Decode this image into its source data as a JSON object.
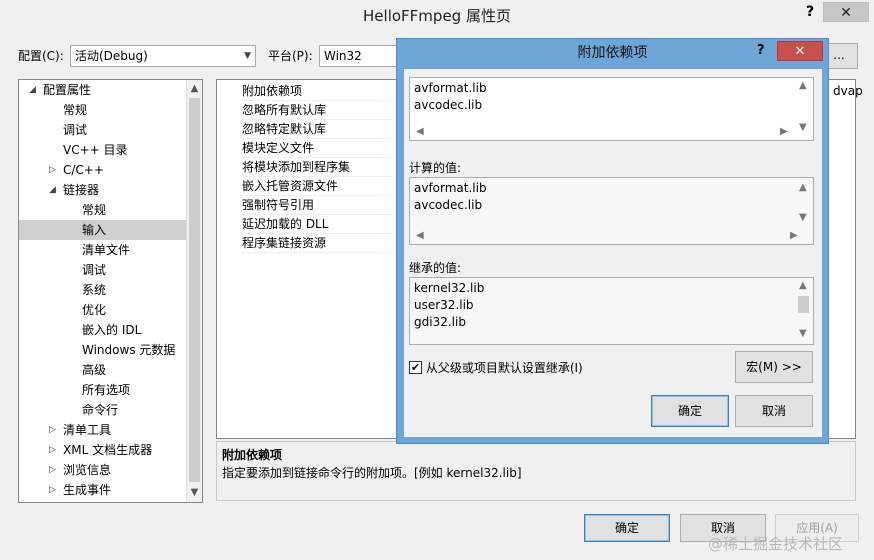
{
  "window": {
    "title": "HelloFFmpeg 属性页",
    "help_label": "?",
    "close_label": "✕"
  },
  "toolbar": {
    "config_label": "配置(C):",
    "config_value": "活动(Debug)",
    "platform_label": "平台(P):",
    "platform_value": "Win32",
    "cfg_manager_label": "..."
  },
  "tree": {
    "items": [
      {
        "label": "配置属性",
        "expander": "◢"
      },
      {
        "label": "常规"
      },
      {
        "label": "调试"
      },
      {
        "label": "VC++ 目录"
      },
      {
        "label": "C/C++",
        "expander": "▷"
      },
      {
        "label": "链接器",
        "expander": "◢"
      },
      {
        "label": "常规"
      },
      {
        "label": "输入"
      },
      {
        "label": "清单文件"
      },
      {
        "label": "调试"
      },
      {
        "label": "系统"
      },
      {
        "label": "优化"
      },
      {
        "label": "嵌入的 IDL"
      },
      {
        "label": "Windows 元数据"
      },
      {
        "label": "高级"
      },
      {
        "label": "所有选项"
      },
      {
        "label": "命令行"
      },
      {
        "label": "清单工具",
        "expander": "▷"
      },
      {
        "label": "XML 文档生成器",
        "expander": "▷"
      },
      {
        "label": "浏览信息",
        "expander": "▷"
      },
      {
        "label": "生成事件",
        "expander": "▷"
      }
    ]
  },
  "properties": {
    "rows": [
      "附加依赖项",
      "忽略所有默认库",
      "忽略特定默认库",
      "模块定义文件",
      "将模块添加到程序集",
      "嵌入托管资源文件",
      "强制符号引用",
      "延迟加载的 DLL",
      "程序集链接资源"
    ],
    "peek_value": "dvap"
  },
  "description": {
    "title": "附加依赖项",
    "text": "指定要添加到链接命令行的附加项。[例如 kernel32.lib]"
  },
  "footer": {
    "ok_label": "确定",
    "cancel_label": "取消",
    "apply_label": "应用(A)"
  },
  "dialog": {
    "title": "附加依赖项",
    "help_label": "?",
    "close_label": "✕",
    "edit_lines": [
      "avformat.lib",
      "avcodec.lib"
    ],
    "computed_label": "计算的值:",
    "computed_lines": [
      "avformat.lib",
      "avcodec.lib"
    ],
    "inherited_label": "继承的值:",
    "inherited_lines": [
      "kernel32.lib",
      "user32.lib",
      "gdi32.lib"
    ],
    "inherit_checkbox_label": "从父级或项目默认设置继承(I)",
    "inherit_checked": true,
    "macro_label": "宏(M) >>",
    "ok_label": "确定",
    "cancel_label": "取消"
  },
  "watermark": "@稀土掘金技术社区"
}
